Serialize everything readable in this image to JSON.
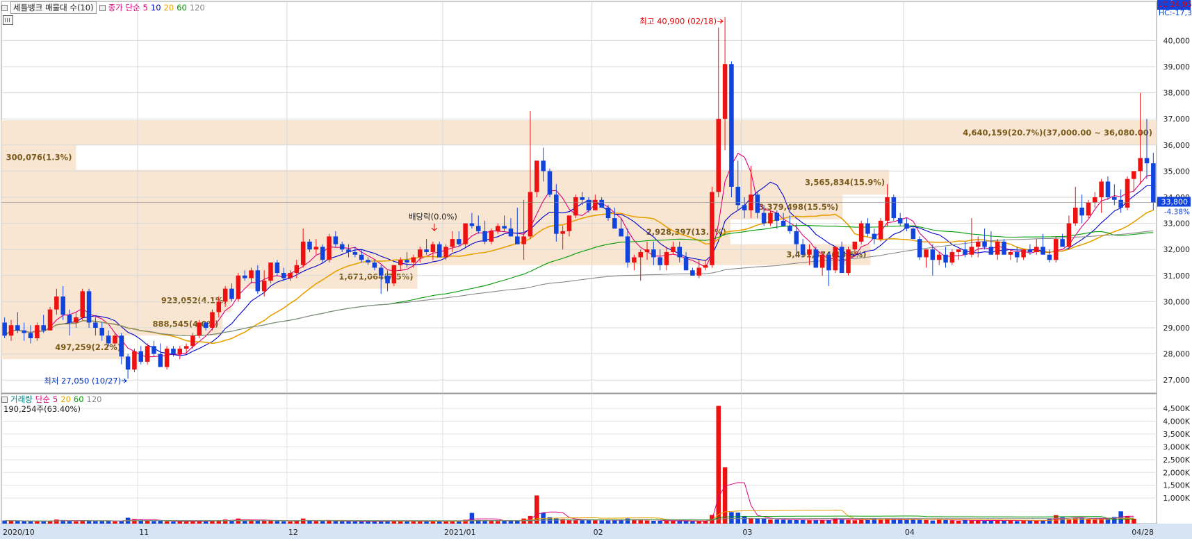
{
  "price_panel": {
    "title": "세틀뱅크 매물대 수(10)",
    "ma_label": "종가 단순",
    "ma_periods": [
      "5",
      "10",
      "20",
      "60",
      "120"
    ],
    "ma_colors": [
      "#e0007a",
      "#0000cc",
      "#e8a000",
      "#009a00",
      "#888888"
    ],
    "lc_text": "LC:24,95",
    "hc_text": "HC:-17,3",
    "current_price": "33,800",
    "current_change": "-4.38%"
  },
  "volume_panel": {
    "title": "거래량",
    "ma_label": "단순",
    "ma_periods": [
      "5",
      "20",
      "60",
      "120"
    ],
    "ma_colors": [
      "#e0007a",
      "#e8a000",
      "#009a00",
      "#888888"
    ],
    "last_volume_text": "190,254주(63.40%)",
    "current_volume": "190,254",
    "current_ratio": "63.40%"
  },
  "chart_data": {
    "type": "candlestick",
    "x_ticks": [
      "2020/10",
      "11",
      "12",
      "2021/01",
      "02",
      "03",
      "04",
      "04/28"
    ],
    "price_axis": {
      "ylim": [
        26500,
        41500
      ],
      "ticks": [
        "27,000",
        "28,000",
        "29,000",
        "30,000",
        "31,000",
        "32,000",
        "33,000",
        "34,000",
        "35,000",
        "36,000",
        "37,000",
        "38,000",
        "39,000",
        "40,000"
      ]
    },
    "volume_axis": {
      "ylim": [
        0,
        4800
      ],
      "ticks": [
        "1,000K",
        "1,500K",
        "2,000K",
        "2,500K",
        "3,000K",
        "3,500K",
        "4,000K",
        "4,500K"
      ]
    },
    "annotations": [
      {
        "text": "최고 40,900 (02/18)",
        "type": "high",
        "price": 40900
      },
      {
        "text": "최저 27,050 (10/27)",
        "type": "low",
        "price": 27050
      },
      {
        "text": "배당락(0.0%)",
        "type": "event",
        "price": 32400
      }
    ],
    "volume_profile": [
      {
        "label": "4,640,159(20.7%)(37,000.00 ~ 36,080.00)",
        "low": 36000,
        "high": 36950
      },
      {
        "label": "300,076(1.3%)",
        "low": 35050,
        "high": 36000
      },
      {
        "label": "3,565,834(15.9%)",
        "low": 34100,
        "high": 35050
      },
      {
        "label": "3,379,498(15.5%)",
        "low": 33150,
        "high": 34100
      },
      {
        "label": "2,928,397(13.1%)",
        "low": 32200,
        "high": 33150
      },
      {
        "label": "3,491,474(15.6%)",
        "low": 31400,
        "high": 32200
      },
      {
        "label": "1,671,064(7.5%)",
        "low": 30500,
        "high": 31400
      },
      {
        "label": "923,052(4.1%)",
        "low": 29600,
        "high": 30500
      },
      {
        "label": "888,545(4.0%)",
        "low": 28700,
        "high": 29600
      },
      {
        "label": "497,259(2.2%)",
        "low": 27800,
        "high": 28700
      }
    ],
    "ohlc": [
      [
        29200,
        29400,
        28600,
        28700
      ],
      [
        28700,
        29300,
        28500,
        29100
      ],
      [
        29100,
        29600,
        28800,
        28900
      ],
      [
        28900,
        29200,
        28500,
        28800
      ],
      [
        28800,
        29100,
        28400,
        28600
      ],
      [
        28600,
        29200,
        28500,
        29100
      ],
      [
        29100,
        29500,
        28800,
        28900
      ],
      [
        28900,
        29800,
        28900,
        29700
      ],
      [
        29700,
        30500,
        29500,
        30200
      ],
      [
        30200,
        30600,
        29300,
        29500
      ],
      [
        29500,
        29700,
        28700,
        29200
      ],
      [
        29200,
        29600,
        29000,
        29400
      ],
      [
        29400,
        30500,
        29300,
        30400
      ],
      [
        30400,
        30500,
        29000,
        29200
      ],
      [
        29200,
        29400,
        28700,
        29000
      ],
      [
        29000,
        29200,
        28500,
        28700
      ],
      [
        28700,
        28900,
        28300,
        28400
      ],
      [
        28400,
        28800,
        28300,
        28700
      ],
      [
        28700,
        28800,
        27600,
        27900
      ],
      [
        27900,
        28000,
        27050,
        27400
      ],
      [
        27400,
        28200,
        27300,
        28100
      ],
      [
        28100,
        28300,
        27600,
        27700
      ],
      [
        27700,
        28400,
        27600,
        28300
      ],
      [
        28300,
        28500,
        27900,
        28000
      ],
      [
        28000,
        28400,
        27500,
        27500
      ],
      [
        27500,
        28300,
        27400,
        28200
      ],
      [
        28200,
        28300,
        27900,
        28000
      ],
      [
        28000,
        28300,
        27800,
        28200
      ],
      [
        28200,
        28400,
        28000,
        28300
      ],
      [
        28300,
        28800,
        28200,
        28700
      ],
      [
        28700,
        29300,
        28600,
        29200
      ],
      [
        29200,
        29200,
        28900,
        29000
      ],
      [
        29000,
        29700,
        28900,
        29600
      ],
      [
        29600,
        30200,
        29400,
        30000
      ],
      [
        30000,
        30600,
        29800,
        30500
      ],
      [
        30500,
        30700,
        30000,
        30100
      ],
      [
        30100,
        31100,
        30000,
        31000
      ],
      [
        31000,
        31200,
        30800,
        30900
      ],
      [
        30900,
        31300,
        30700,
        31200
      ],
      [
        31200,
        31400,
        30300,
        30400
      ],
      [
        30400,
        31200,
        30200,
        30800
      ],
      [
        30800,
        31500,
        30700,
        31500
      ],
      [
        31500,
        31600,
        31000,
        31100
      ],
      [
        31100,
        31300,
        30800,
        30900
      ],
      [
        30900,
        31200,
        30800,
        31100
      ],
      [
        31100,
        31600,
        30900,
        31400
      ],
      [
        31400,
        32800,
        31300,
        32300
      ],
      [
        32300,
        32400,
        31900,
        32000
      ],
      [
        32000,
        32400,
        31800,
        32100
      ],
      [
        32100,
        32200,
        31500,
        31600
      ],
      [
        31600,
        32600,
        31500,
        32500
      ],
      [
        32500,
        32700,
        32100,
        32200
      ],
      [
        32200,
        32300,
        31900,
        32000
      ],
      [
        32000,
        32200,
        31700,
        31900
      ],
      [
        31900,
        32100,
        31700,
        31800
      ],
      [
        31800,
        32000,
        31500,
        31600
      ],
      [
        31600,
        31700,
        31400,
        31500
      ],
      [
        31500,
        31600,
        31200,
        31300
      ],
      [
        31300,
        31400,
        30300,
        31000
      ],
      [
        31000,
        31200,
        30400,
        30700
      ],
      [
        30700,
        31400,
        30600,
        31400
      ],
      [
        31400,
        31700,
        31200,
        31600
      ],
      [
        31600,
        31900,
        31300,
        31500
      ],
      [
        31500,
        31800,
        31300,
        31700
      ],
      [
        31700,
        32100,
        31500,
        32000
      ],
      [
        32000,
        32400,
        31800,
        31900
      ],
      [
        31900,
        32300,
        31600,
        32200
      ],
      [
        32200,
        32300,
        31700,
        31700
      ],
      [
        31700,
        32200,
        31600,
        32100
      ],
      [
        32100,
        32700,
        31900,
        32400
      ],
      [
        32400,
        32700,
        32100,
        32200
      ],
      [
        32200,
        33000,
        32100,
        33000
      ],
      [
        33000,
        33400,
        32800,
        32900
      ],
      [
        32900,
        33300,
        32600,
        32700
      ],
      [
        32700,
        33100,
        32200,
        32300
      ],
      [
        32300,
        32800,
        32200,
        32700
      ],
      [
        32700,
        33000,
        32600,
        32900
      ],
      [
        32900,
        33300,
        32700,
        32800
      ],
      [
        32800,
        33200,
        32500,
        32500
      ],
      [
        32500,
        33600,
        32200,
        32200
      ],
      [
        32200,
        33900,
        31600,
        32500
      ],
      [
        32500,
        37300,
        32400,
        34200
      ],
      [
        34200,
        35400,
        34000,
        35400
      ],
      [
        35400,
        35900,
        34600,
        35000
      ],
      [
        35000,
        35100,
        34000,
        34100
      ],
      [
        34100,
        34500,
        32300,
        32600
      ],
      [
        32600,
        32900,
        32000,
        32700
      ],
      [
        32700,
        33200,
        32500,
        33300
      ],
      [
        33300,
        34100,
        33200,
        34000
      ],
      [
        34000,
        34200,
        33700,
        33900
      ],
      [
        33900,
        34000,
        33400,
        33500
      ],
      [
        33500,
        34100,
        33500,
        33900
      ],
      [
        33900,
        34000,
        33600,
        33600
      ],
      [
        33600,
        33700,
        33100,
        33200
      ],
      [
        33200,
        33600,
        32800,
        32800
      ],
      [
        32800,
        33200,
        32500,
        32500
      ],
      [
        32500,
        32800,
        31300,
        31500
      ],
      [
        31500,
        31800,
        31200,
        31700
      ],
      [
        31700,
        32000,
        30800,
        31900
      ],
      [
        31900,
        32300,
        31600,
        32000
      ],
      [
        32000,
        32300,
        31400,
        31700
      ],
      [
        31700,
        32000,
        31200,
        31400
      ],
      [
        31400,
        32100,
        31200,
        31900
      ],
      [
        31900,
        32300,
        31800,
        32100
      ],
      [
        32100,
        32300,
        31500,
        31700
      ],
      [
        31700,
        31900,
        31200,
        31200
      ],
      [
        31200,
        31300,
        31000,
        31000
      ],
      [
        31000,
        31600,
        30900,
        31300
      ],
      [
        31300,
        31600,
        31200,
        31400
      ],
      [
        31400,
        34400,
        31300,
        34200
      ],
      [
        34200,
        40500,
        34000,
        37000
      ],
      [
        37000,
        40900,
        35800,
        39100
      ],
      [
        39100,
        39200,
        34000,
        34400
      ],
      [
        34400,
        35400,
        33500,
        33700
      ],
      [
        33700,
        34000,
        33200,
        33500
      ],
      [
        33500,
        35200,
        33200,
        34100
      ],
      [
        34100,
        34200,
        33200,
        33400
      ],
      [
        33400,
        33700,
        32900,
        33000
      ],
      [
        33000,
        33500,
        32900,
        33400
      ],
      [
        33400,
        33500,
        32800,
        33100
      ],
      [
        33100,
        33400,
        32900,
        32900
      ],
      [
        32900,
        33300,
        32600,
        32700
      ],
      [
        32700,
        33000,
        31700,
        32200
      ],
      [
        32200,
        32400,
        31700,
        31800
      ],
      [
        31800,
        32200,
        31400,
        32000
      ],
      [
        32000,
        32100,
        31300,
        31300
      ],
      [
        31300,
        31900,
        31000,
        31800
      ],
      [
        31800,
        31900,
        30600,
        31200
      ],
      [
        31200,
        32100,
        31100,
        32100
      ],
      [
        32100,
        32300,
        31100,
        31100
      ],
      [
        31100,
        32100,
        31000,
        32000
      ],
      [
        32000,
        32200,
        31800,
        32300
      ],
      [
        32300,
        33100,
        32200,
        33000
      ],
      [
        33000,
        33200,
        32500,
        32600
      ],
      [
        32600,
        32800,
        32200,
        32400
      ],
      [
        32400,
        33200,
        32300,
        33100
      ],
      [
        33100,
        34500,
        32900,
        34000
      ],
      [
        34000,
        34100,
        33100,
        33200
      ],
      [
        33200,
        33400,
        32900,
        33000
      ],
      [
        33000,
        33200,
        32700,
        32800
      ],
      [
        32800,
        32900,
        32400,
        32400
      ],
      [
        32400,
        32500,
        31600,
        31700
      ],
      [
        31700,
        32000,
        31300,
        32000
      ],
      [
        32000,
        32200,
        31000,
        31600
      ],
      [
        31600,
        31900,
        31400,
        31800
      ],
      [
        31800,
        32100,
        31300,
        31500
      ],
      [
        31500,
        32000,
        31400,
        31900
      ],
      [
        31900,
        32000,
        31600,
        32000
      ],
      [
        32000,
        32300,
        31700,
        31800
      ],
      [
        31800,
        33200,
        31700,
        32100
      ],
      [
        32100,
        32500,
        31700,
        32300
      ],
      [
        32300,
        32800,
        32000,
        32100
      ],
      [
        32100,
        32700,
        31900,
        31800
      ],
      [
        31800,
        32400,
        31600,
        32300
      ],
      [
        32300,
        32400,
        31800,
        31800
      ],
      [
        31800,
        32000,
        31600,
        31900
      ],
      [
        31900,
        32100,
        31500,
        31700
      ],
      [
        31700,
        32000,
        31600,
        32000
      ],
      [
        32000,
        32200,
        31800,
        31900
      ],
      [
        31900,
        32400,
        31800,
        32100
      ],
      [
        32100,
        32600,
        31800,
        31800
      ],
      [
        31800,
        32000,
        31500,
        31600
      ],
      [
        31600,
        32500,
        31500,
        32400
      ],
      [
        32400,
        32600,
        32100,
        32100
      ],
      [
        32100,
        33300,
        32000,
        33000
      ],
      [
        33000,
        34400,
        32900,
        33600
      ],
      [
        33600,
        34100,
        33000,
        33300
      ],
      [
        33300,
        33900,
        33200,
        33800
      ],
      [
        33800,
        34200,
        33600,
        34000
      ],
      [
        34000,
        34700,
        33400,
        34600
      ],
      [
        34600,
        34800,
        33900,
        34000
      ],
      [
        34000,
        34500,
        33700,
        33900
      ],
      [
        33900,
        34300,
        33400,
        33600
      ],
      [
        33600,
        34800,
        33500,
        34700
      ],
      [
        34700,
        35000,
        34200,
        35000
      ],
      [
        35000,
        38000,
        34500,
        35500
      ],
      [
        35500,
        37000,
        34700,
        35300
      ],
      [
        35300,
        35700,
        33500,
        33800
      ]
    ],
    "volume": [
      120,
      110,
      105,
      100,
      95,
      90,
      95,
      110,
      160,
      140,
      95,
      90,
      120,
      130,
      110,
      100,
      100,
      90,
      120,
      230,
      180,
      150,
      110,
      100,
      110,
      90,
      80,
      85,
      85,
      100,
      110,
      100,
      120,
      130,
      160,
      140,
      200,
      120,
      120,
      140,
      120,
      140,
      100,
      90,
      85,
      100,
      200,
      110,
      100,
      100,
      130,
      100,
      90,
      90,
      90,
      80,
      90,
      85,
      120,
      100,
      100,
      90,
      90,
      90,
      110,
      90,
      100,
      85,
      100,
      120,
      100,
      150,
      420,
      140,
      120,
      110,
      100,
      110,
      100,
      120,
      200,
      300,
      1100,
      420,
      250,
      200,
      180,
      150,
      140,
      160,
      160,
      130,
      120,
      120,
      140,
      150,
      200,
      160,
      140,
      120,
      110,
      110,
      110,
      110,
      110,
      100,
      90,
      90,
      100,
      340,
      4600,
      2200,
      450,
      430,
      300,
      220,
      210,
      200,
      160,
      160,
      150,
      140,
      140,
      150,
      130,
      130,
      140,
      130,
      220,
      180,
      140,
      130,
      140,
      150,
      200,
      180,
      190,
      170,
      160,
      150,
      180,
      170,
      140,
      120,
      180,
      150,
      130,
      110,
      140,
      120,
      110,
      120,
      140,
      120,
      120,
      120,
      100,
      140,
      110,
      110,
      120,
      190,
      330,
      250,
      180,
      200,
      220,
      190,
      170,
      200,
      220,
      260,
      480,
      290,
      190
    ]
  }
}
